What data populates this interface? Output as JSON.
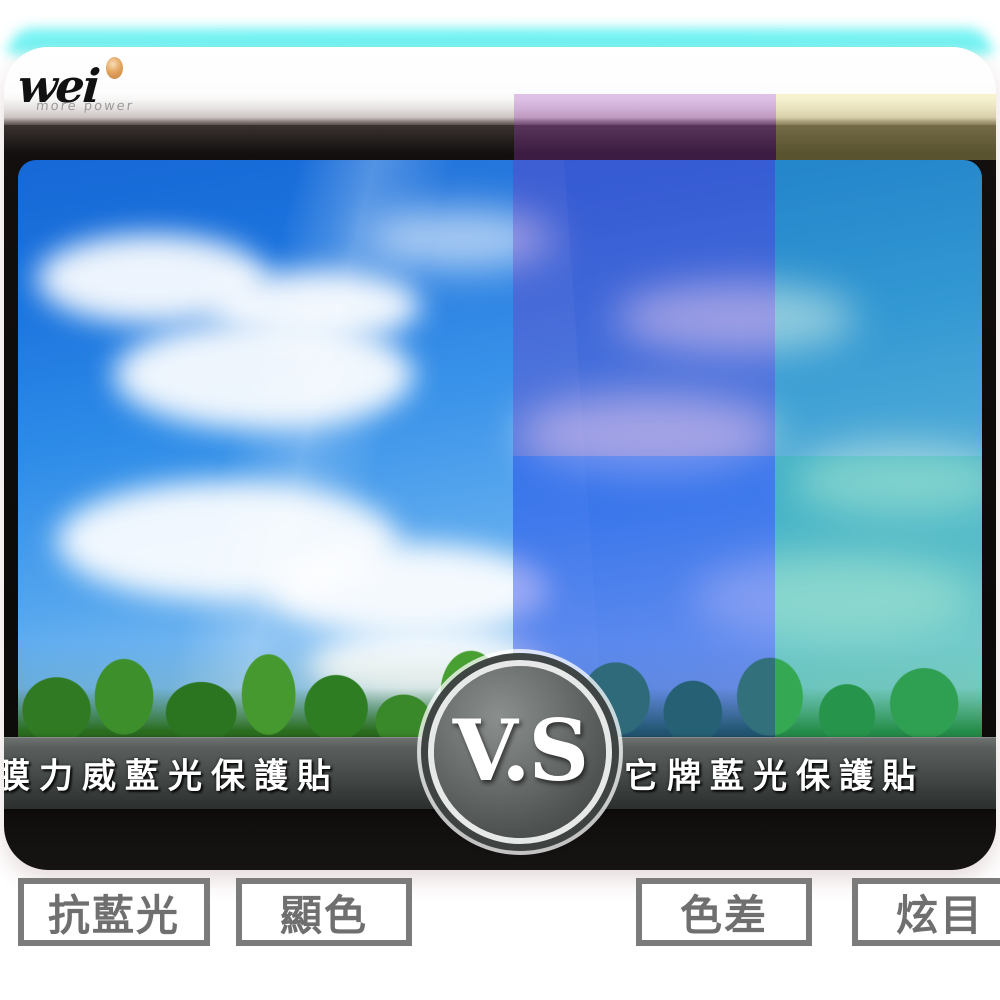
{
  "brand": {
    "wordmark": "wei",
    "tagline": "more power",
    "logo_dot_color": "#e3a561"
  },
  "comparison": {
    "badge_text": "V.S",
    "left_label": "膜力威藍光保護貼",
    "right_label": "它牌藍光保護貼"
  },
  "feature_boxes": [
    {
      "label": "抗藍光"
    },
    {
      "label": "顯色"
    },
    {
      "label": "色差"
    },
    {
      "label": "炫目"
    }
  ],
  "colors": {
    "accent_glow": "#6ff2f2",
    "banner_text": "#ffffff",
    "box_border": "#7b7b7b",
    "box_text": "#6f6f6f",
    "tint_purple": "#a03cbe",
    "tint_blue": "#1937e6",
    "tint_green": "#1ebe8c",
    "tint_cream": "#eee278"
  },
  "photo": {
    "description": "sky-with-clouds-and-treeline"
  }
}
